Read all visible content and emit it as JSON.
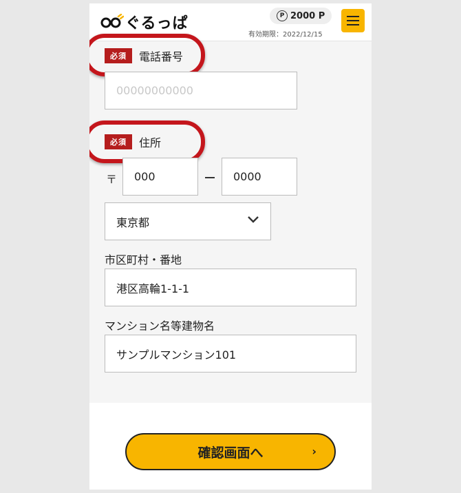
{
  "header": {
    "logo_text": "ぐるっぱ",
    "points": "2000 P",
    "points_icon_label": "P",
    "expiry": "有効期限：2022/12/15",
    "menu_icon": "hamburger-menu-icon",
    "accent_color": "#f8b500"
  },
  "form": {
    "required_badge": "必須",
    "phone": {
      "label": "電話番号",
      "placeholder": "00000000000",
      "value": ""
    },
    "address": {
      "label": "住所",
      "postal_mark": "〒",
      "postal_first": "000",
      "postal_second": "0000",
      "prefecture": "東京都",
      "city_label": "市区町村・番地",
      "city_value": "港区高輪1-1-1",
      "building_label": "マンション名等建物名",
      "building_value": "サンプルマンション101"
    }
  },
  "footer": {
    "confirm_label": "確認画面へ",
    "confirm_arrow": "›"
  },
  "colors": {
    "required_badge": "#b51d1d",
    "highlight_ring": "#c4161c",
    "button": "#f8b500"
  }
}
